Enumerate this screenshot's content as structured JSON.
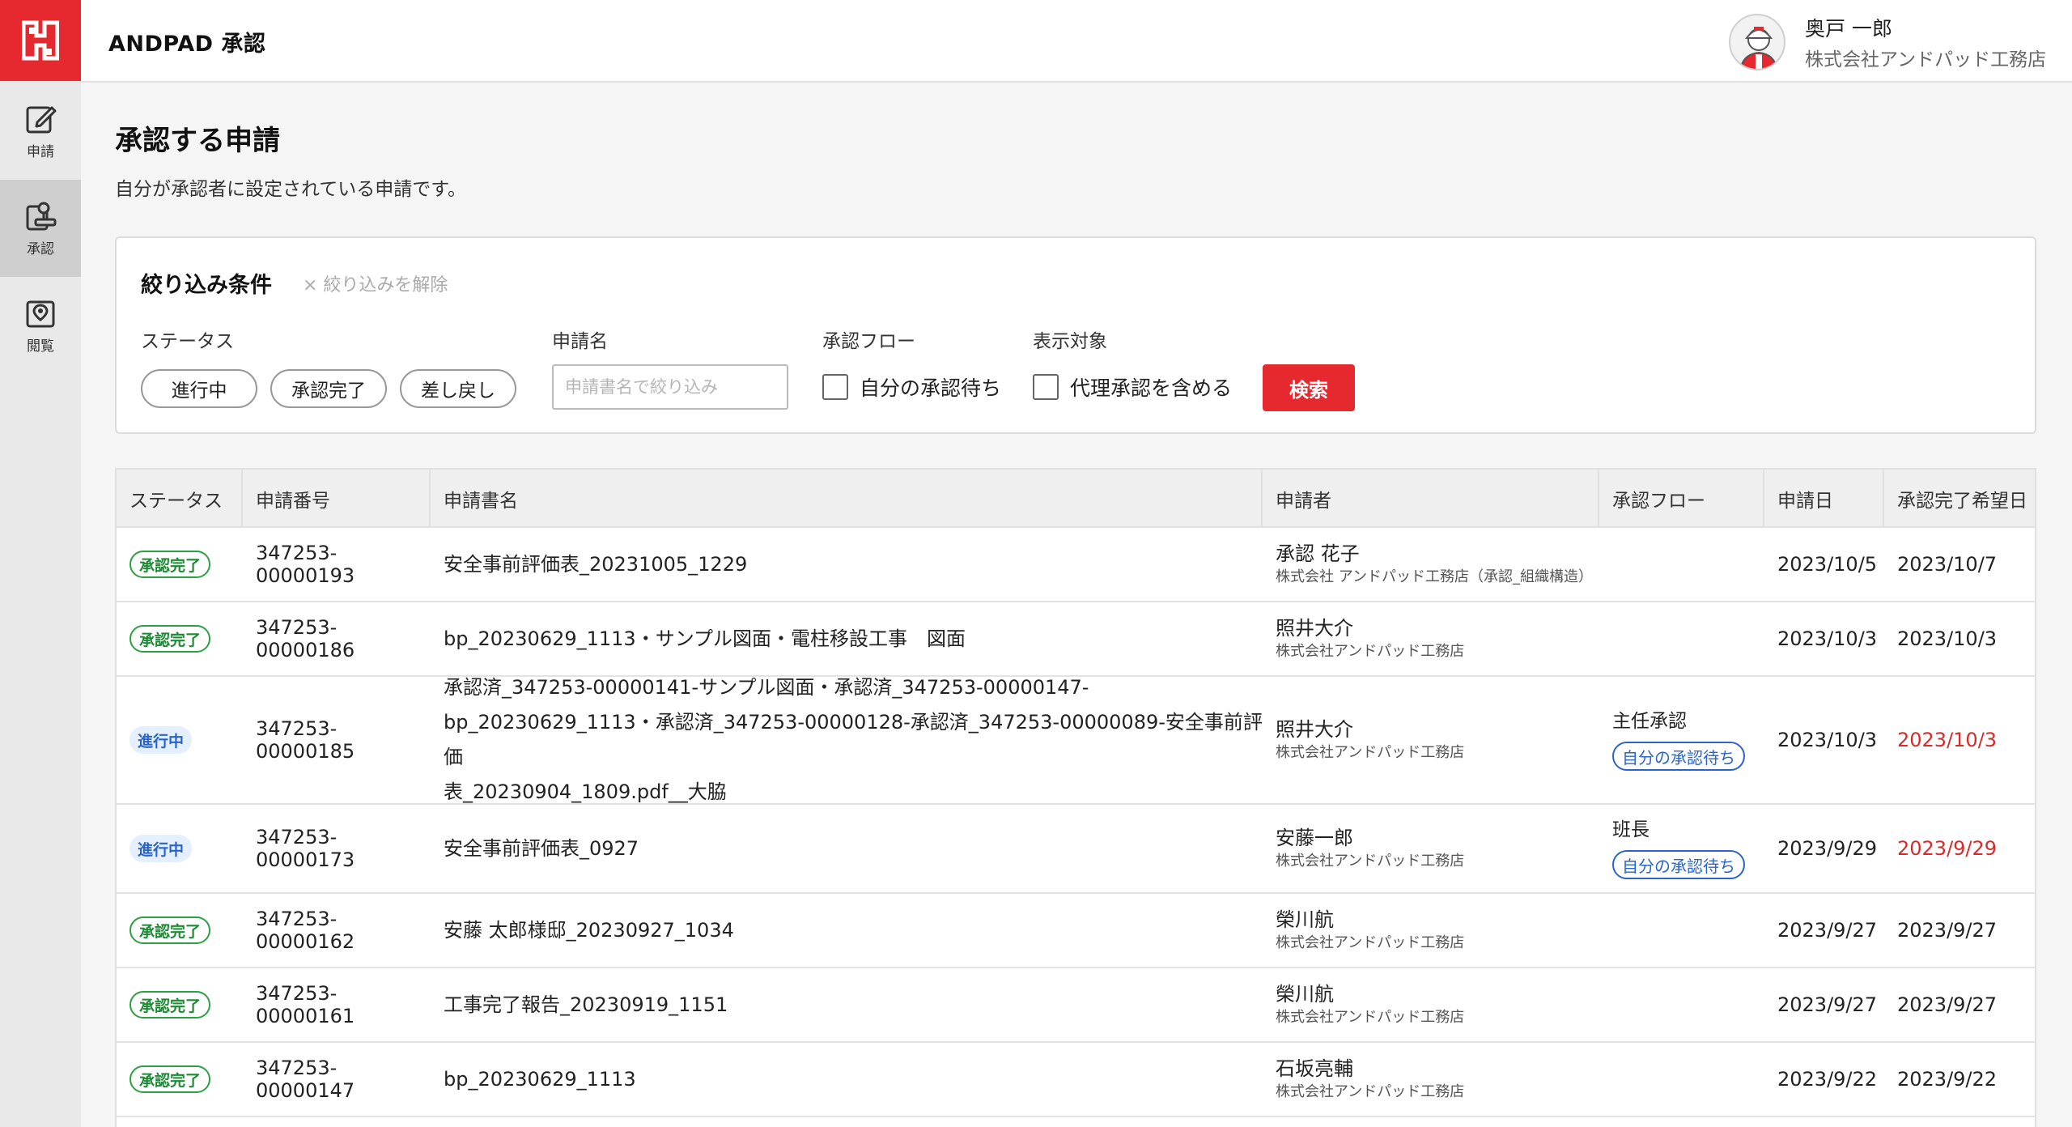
{
  "header": {
    "app_title": "ANDPAD 承認",
    "user_name": "奥戸 一郎",
    "user_company": "株式会社アンドパッド工務店"
  },
  "sidebar": {
    "items": [
      {
        "label": "申請",
        "icon": "edit-icon"
      },
      {
        "label": "承認",
        "icon": "approve-icon"
      },
      {
        "label": "閲覧",
        "icon": "view-icon"
      }
    ],
    "active_index": 1
  },
  "page": {
    "title": "承認する申請",
    "description": "自分が承認者に設定されている申請です。"
  },
  "filter": {
    "title": "絞り込み条件",
    "clear_label": "× 絞り込みを解除",
    "status_label": "ステータス",
    "status_options": [
      "進行中",
      "承認完了",
      "差し戻し"
    ],
    "name_label": "申請名",
    "name_placeholder": "申請書名で絞り込み",
    "flow_label": "承認フロー",
    "flow_checkbox": "自分の承認待ち",
    "target_label": "表示対象",
    "target_checkbox": "代理承認を含める",
    "search_button": "検索"
  },
  "table": {
    "headers": [
      "ステータス",
      "申請番号",
      "申請書名",
      "申請者",
      "承認フロー",
      "申請日",
      "承認完了希望日"
    ],
    "rows": [
      {
        "status": "承認完了",
        "number": "347253-00000193",
        "name": [
          "安全事前評価表_20231005_1229"
        ],
        "applicant": "承認 花子",
        "company": "株式会社 アンドパッド工務店（承認_組織構造）",
        "flow": "",
        "flow_badge": "",
        "date": "2023/10/5",
        "due": "2023/10/7",
        "due_overdue": false
      },
      {
        "status": "承認完了",
        "number": "347253-00000186",
        "name": [
          "bp_20230629_1113・サンプル図面・電柱移設工事　図面"
        ],
        "applicant": "照井大介",
        "company": "株式会社アンドパッド工務店",
        "flow": "",
        "flow_badge": "",
        "date": "2023/10/3",
        "due": "2023/10/3",
        "due_overdue": false
      },
      {
        "status": "進行中",
        "number": "347253-00000185",
        "name": [
          "承認済_347253-00000141-サンプル図面・承認済_347253-00000147-",
          "bp_20230629_1113・承認済_347253-00000128-承認済_347253-00000089-安全事前評価",
          "表_20230904_1809.pdf__大脇"
        ],
        "applicant": "照井大介",
        "company": "株式会社アンドパッド工務店",
        "flow": "主任承認",
        "flow_badge": "自分の承認待ち",
        "date": "2023/10/3",
        "due": "2023/10/3",
        "due_overdue": true
      },
      {
        "status": "進行中",
        "number": "347253-00000173",
        "name": [
          "安全事前評価表_0927"
        ],
        "applicant": "安藤一郎",
        "company": "株式会社アンドパッド工務店",
        "flow": "班長",
        "flow_badge": "自分の承認待ち",
        "date": "2023/9/29",
        "due": "2023/9/29",
        "due_overdue": true
      },
      {
        "status": "承認完了",
        "number": "347253-00000162",
        "name": [
          "安藤 太郎様邸_20230927_1034"
        ],
        "applicant": "榮川航",
        "company": "株式会社アンドパッド工務店",
        "flow": "",
        "flow_badge": "",
        "date": "2023/9/27",
        "due": "2023/9/27",
        "due_overdue": false
      },
      {
        "status": "承認完了",
        "number": "347253-00000161",
        "name": [
          "工事完了報告_20230919_1151"
        ],
        "applicant": "榮川航",
        "company": "株式会社アンドパッド工務店",
        "flow": "",
        "flow_badge": "",
        "date": "2023/9/27",
        "due": "2023/9/27",
        "due_overdue": false
      },
      {
        "status": "承認完了",
        "number": "347253-00000147",
        "name": [
          "bp_20230629_1113"
        ],
        "applicant": "石坂亮輔",
        "company": "株式会社アンドパッド工務店",
        "flow": "",
        "flow_badge": "",
        "date": "2023/9/22",
        "due": "2023/9/22",
        "due_overdue": false
      }
    ]
  },
  "colors": {
    "brand": "#e6282f",
    "done": "#1f8a36",
    "progress": "#2a64c9",
    "overdue": "#d62b2b"
  }
}
